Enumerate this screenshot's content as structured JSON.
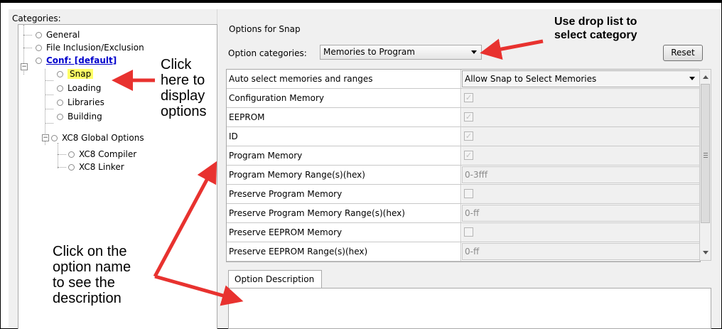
{
  "left": {
    "categories_label": "Categories:",
    "tree": [
      {
        "label": "General"
      },
      {
        "label": "File Inclusion/Exclusion"
      },
      {
        "label": "Conf: [default]"
      },
      {
        "label": "Snap"
      },
      {
        "label": "Loading"
      },
      {
        "label": "Libraries"
      },
      {
        "label": "Building"
      },
      {
        "label": "XC8 Global Options"
      },
      {
        "label": "XC8 Compiler"
      },
      {
        "label": "XC8 Linker"
      }
    ]
  },
  "right": {
    "options_for": "Options for Snap",
    "option_categories_label": "Option categories:",
    "option_categories_value": "Memories to Program",
    "reset_label": "Reset",
    "rows": [
      {
        "name": "Auto select memories and ranges",
        "value": "Allow Snap to Select Memories",
        "kind": "combo"
      },
      {
        "name": "Configuration Memory",
        "kind": "check",
        "checked": true
      },
      {
        "name": "EEPROM",
        "kind": "check",
        "checked": true
      },
      {
        "name": "ID",
        "kind": "check",
        "checked": true
      },
      {
        "name": "Program Memory",
        "kind": "check",
        "checked": true
      },
      {
        "name": "Program Memory Range(s)(hex)",
        "value": "0-3fff",
        "kind": "text"
      },
      {
        "name": "Preserve Program Memory",
        "kind": "check",
        "checked": false
      },
      {
        "name": "Preserve Program Memory Range(s)(hex)",
        "value": "0-ff",
        "kind": "text"
      },
      {
        "name": "Preserve EEPROM Memory",
        "kind": "check",
        "checked": false
      },
      {
        "name": "Preserve EEPROM Range(s)(hex)",
        "value": "0-ff",
        "kind": "text"
      }
    ],
    "description_tab": "Option Description"
  },
  "annotations": {
    "click_here_lines": [
      "Click",
      "here to",
      "display",
      "options"
    ],
    "drop_list_lines": [
      "Use drop list to",
      "select category"
    ],
    "option_name_lines": [
      "Click on the",
      "option name",
      "to see the",
      "description"
    ]
  },
  "colors": {
    "arrow": "#e8322f",
    "highlight": "#ffff66",
    "link": "#0000cc"
  }
}
